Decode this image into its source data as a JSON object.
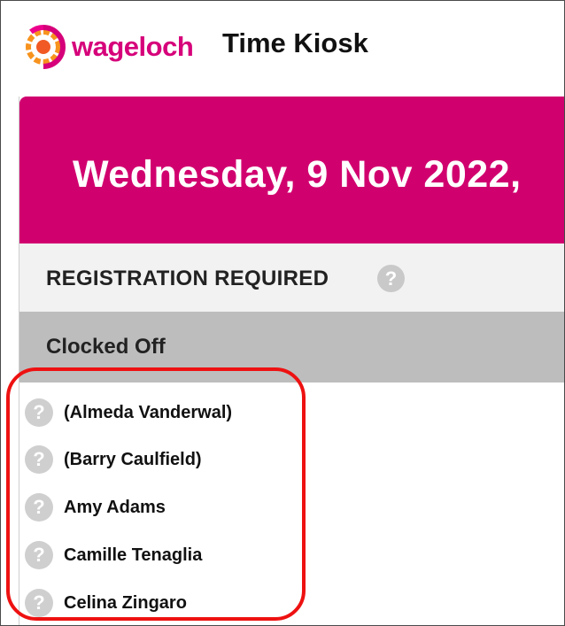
{
  "brand": {
    "name": "wageloch",
    "color": "#d6007a",
    "logo_icon": "wageloch-logo-icon"
  },
  "header": {
    "title": "Time Kiosk"
  },
  "banner": {
    "date_text": "Wednesday, 9 Nov 2022,",
    "background": "#d1006f"
  },
  "registration": {
    "label": "REGISTRATION REQUIRED",
    "help_icon": "question-icon"
  },
  "clocked_off": {
    "label": "Clocked Off"
  },
  "employees": [
    {
      "name": "(Almeda Vanderwal)",
      "icon": "question-icon"
    },
    {
      "name": "(Barry Caulfield)",
      "icon": "question-icon"
    },
    {
      "name": "Amy Adams",
      "icon": "question-icon"
    },
    {
      "name": "Camille Tenaglia",
      "icon": "question-icon"
    },
    {
      "name": "Celina Zingaro",
      "icon": "question-icon"
    }
  ],
  "annotation": {
    "highlight_color": "#ee1111"
  }
}
